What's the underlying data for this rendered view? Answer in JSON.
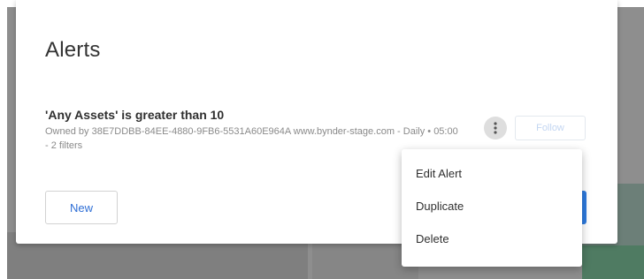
{
  "dialog": {
    "title": "Alerts"
  },
  "alert": {
    "title": "'Any Assets' is greater than 10",
    "description": "Owned by 38E7DDBB-84EE-4880-9FB6-5531A60E964A www.bynder-stage.com - Daily • 05:00 - 2 filters",
    "follow_label": "Follow"
  },
  "actions": {
    "new_label": "New"
  },
  "menu": {
    "items": [
      {
        "label": "Edit Alert"
      },
      {
        "label": "Duplicate"
      },
      {
        "label": "Delete"
      }
    ]
  },
  "icons": {
    "more_actions": "more-vertical-icon"
  },
  "colors": {
    "link_blue": "#2f6fd6",
    "primary_blue": "#2d7be0",
    "follow_disabled": "#c3d6f2"
  }
}
